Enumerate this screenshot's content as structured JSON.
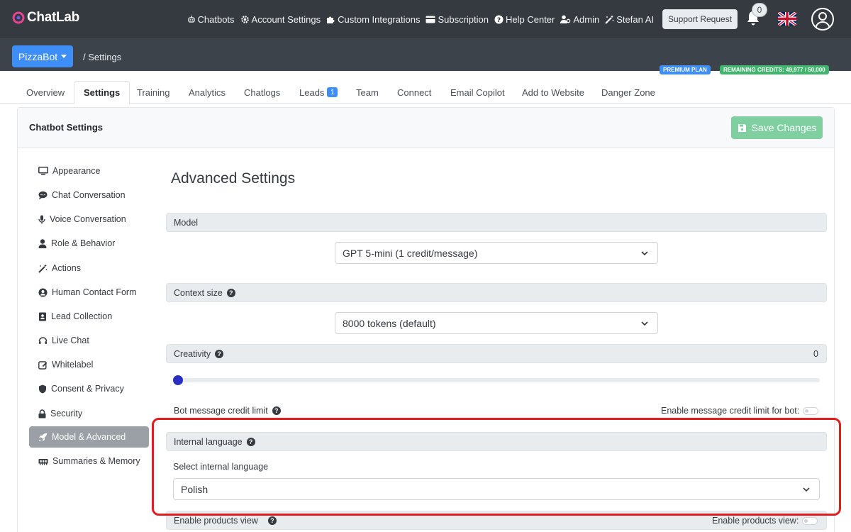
{
  "brand": {
    "name": "ChatLab"
  },
  "nav": {
    "items": [
      {
        "label": "Chatbots",
        "icon": "robot-icon"
      },
      {
        "label": "Account Settings",
        "icon": "gear-icon"
      },
      {
        "label": "Custom Integrations",
        "icon": "puzzle-icon"
      },
      {
        "label": "Subscription",
        "icon": "credit-card-icon"
      },
      {
        "label": "Help Center",
        "icon": "question-circle-icon"
      },
      {
        "label": "Admin",
        "icon": "user-gear-icon"
      },
      {
        "label": "Stefan AI",
        "icon": "magic-wand-icon"
      }
    ],
    "support_label": "Support Request",
    "notifications_count": "0"
  },
  "subbar": {
    "bot_name": "PizzaBot",
    "breadcrumb": "/  Settings",
    "plan": "PREMIUM PLAN",
    "credits": "REMAINING CREDITS: 49,977 / 50,000"
  },
  "tabs": [
    {
      "label": "Overview"
    },
    {
      "label": "Settings",
      "active": true
    },
    {
      "label": "Training"
    },
    {
      "label": "Analytics"
    },
    {
      "label": "Chatlogs"
    },
    {
      "label": "Leads",
      "badge": "1"
    },
    {
      "label": "Team"
    },
    {
      "label": "Connect"
    },
    {
      "label": "Email Copilot"
    },
    {
      "label": "Add to Website"
    },
    {
      "label": "Danger Zone"
    }
  ],
  "card": {
    "title": "Chatbot Settings",
    "save_label": "Save Changes"
  },
  "sidebar": {
    "items": [
      {
        "label": "Appearance",
        "icon": "monitor-icon"
      },
      {
        "label": "Chat Conversation",
        "icon": "chat-bubble-icon"
      },
      {
        "label": "Voice Conversation",
        "icon": "microphone-icon"
      },
      {
        "label": "Role & Behavior",
        "icon": "user-icon"
      },
      {
        "label": "Actions",
        "icon": "magic-wand-icon"
      },
      {
        "label": "Human Contact Form",
        "icon": "user-circle-icon"
      },
      {
        "label": "Lead Collection",
        "icon": "address-book-icon"
      },
      {
        "label": "Live Chat",
        "icon": "headset-icon"
      },
      {
        "label": "Whitelabel",
        "icon": "edit-icon"
      },
      {
        "label": "Consent & Privacy",
        "icon": "shield-icon"
      },
      {
        "label": "Security",
        "icon": "lock-icon"
      },
      {
        "label": "Model & Advanced",
        "icon": "rocket-icon",
        "active": true
      },
      {
        "label": "Summaries & Memory",
        "icon": "memory-icon"
      }
    ]
  },
  "main": {
    "heading": "Advanced Settings",
    "model": {
      "label": "Model",
      "value": "GPT 5-mini (1 credit/message)"
    },
    "context": {
      "label": "Context size",
      "value": "8000 tokens (default)"
    },
    "creativity": {
      "label": "Creativity",
      "value": "0",
      "level": 0
    },
    "credit_limit": {
      "label": "Bot message credit limit",
      "toggle_label": "Enable message credit limit for bot:"
    },
    "internal_language": {
      "label": "Internal language",
      "select_label": "Select internal language",
      "value": "Polish"
    },
    "products": {
      "label": "Enable products view",
      "toggle_label": "Enable products view:"
    }
  },
  "colors": {
    "primary": "#3e8ef7",
    "success": "#3fb66b",
    "navbar": "#343a40",
    "highlight": "#e11d1d"
  }
}
